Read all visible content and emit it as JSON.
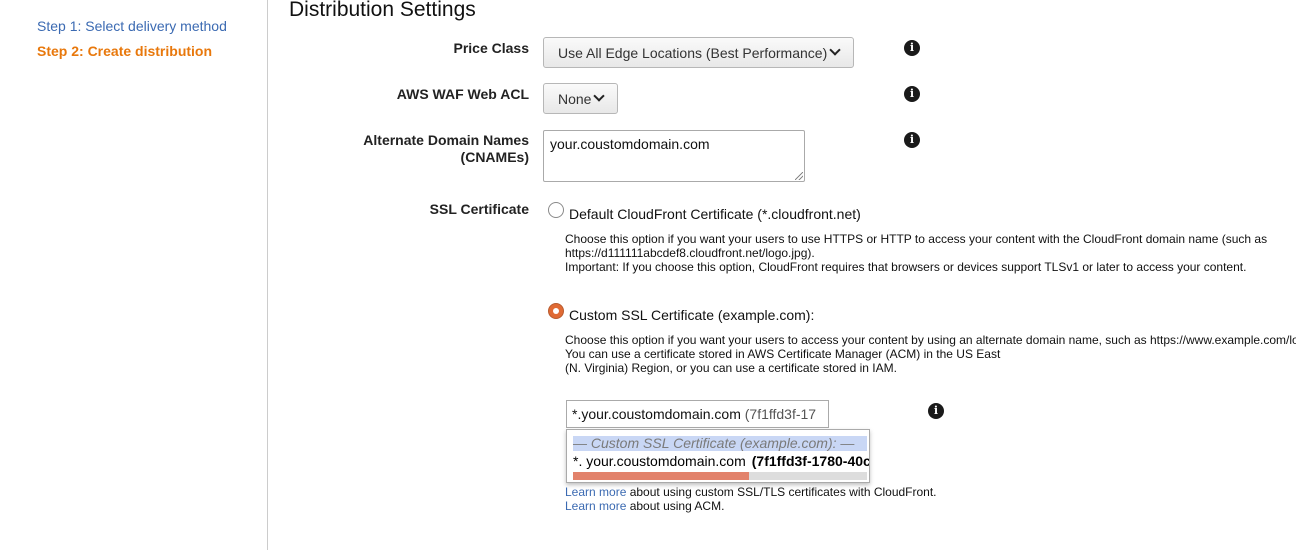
{
  "sidebar": {
    "steps": [
      {
        "label": "Step 1: Select delivery method",
        "state": "inactive"
      },
      {
        "label": "Step 2: Create distribution",
        "state": "active"
      }
    ]
  },
  "page": {
    "heading": "Distribution Settings"
  },
  "form": {
    "price_class": {
      "label": "Price Class",
      "value": "Use All Edge Locations (Best Performance)"
    },
    "waf": {
      "label": "AWS WAF Web ACL",
      "value": "None"
    },
    "cnames": {
      "label_line1": "Alternate Domain Names",
      "label_line2": "(CNAMEs)",
      "value": "your.coustomdomain.com"
    },
    "ssl": {
      "label": "SSL Certificate",
      "default_option": {
        "label": "Default CloudFront Certificate (*.cloudfront.net)",
        "desc_line1": "Choose this option if you want your users to use HTTPS or HTTP to access your content with the CloudFront domain name (such as",
        "desc_line2": "https://d111111abcdef8.cloudfront.net/logo.jpg).",
        "desc_line3": "Important: If you choose this option, CloudFront requires that browsers or devices support TLSv1 or later to access your content.",
        "selected": false
      },
      "custom_option": {
        "label": "Custom SSL Certificate (example.com):",
        "desc_line1": "Choose this option if you want your users to access your content by using an alternate domain name, such as https://www.example.com/lo",
        "desc_line2": "You can use a certificate stored in AWS Certificate Manager (ACM) in the US East",
        "desc_line3": "(N. Virginia) Region, or you can use a certificate stored in IAM.",
        "selected": true
      },
      "cert_input": {
        "domain": "*.your.coustomdomain.com",
        "id": "(7f1ffd3f-17"
      },
      "dropdown": {
        "group_label": "— Custom SSL Certificate (example.com): —",
        "option_domain": "*. your.coustomdomain.com",
        "option_id": "(7f1ffd3f-1780-40c",
        "scroll_fraction": 0.6
      },
      "learn_more_1": {
        "link": "Learn more",
        "text": " about using custom SSL/TLS certificates with CloudFront."
      },
      "learn_more_2": {
        "link": "Learn more",
        "text": " about using ACM."
      }
    }
  },
  "icons": {
    "info": "info-icon",
    "chevron": "chevron-down-icon"
  },
  "colors": {
    "active_step": "#e8780c",
    "link": "#3b6ab2",
    "radio_selected": "#e06a34",
    "dropdown_highlight": "#c9d7f5"
  }
}
